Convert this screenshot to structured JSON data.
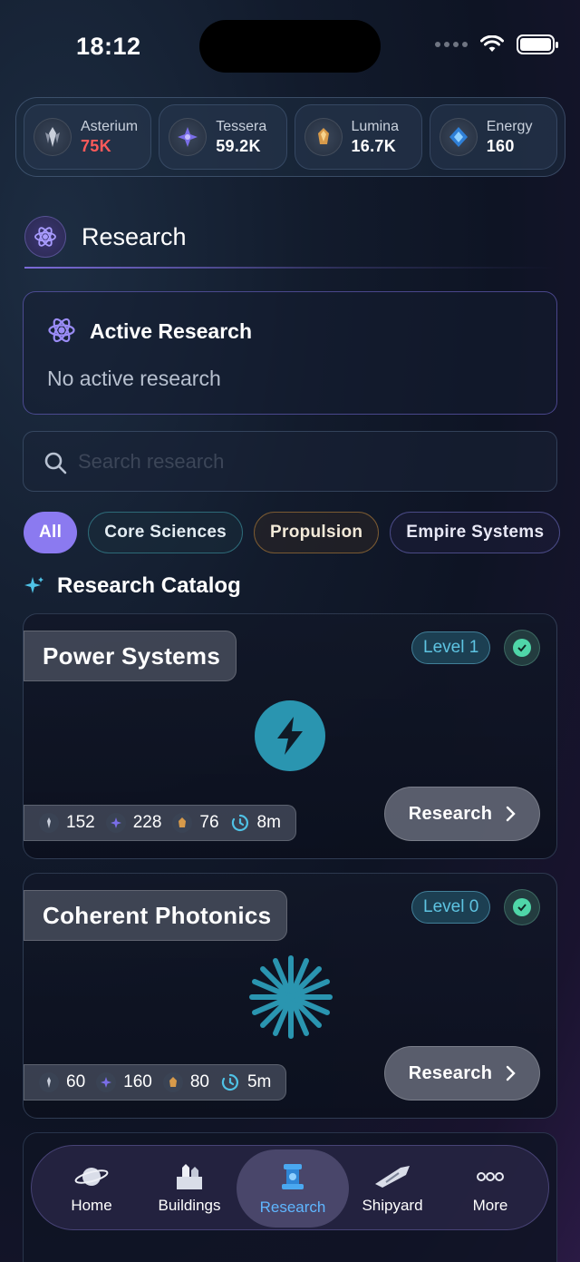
{
  "status_bar": {
    "time": "18:12"
  },
  "resources": [
    {
      "label": "Asterium",
      "value": "75K",
      "value_color": "#ff5a5a",
      "icon": "asterium-crystal-icon"
    },
    {
      "label": "Tessera",
      "value": "59.2K",
      "value_color": "#ffffff",
      "icon": "tessera-crystal-icon"
    },
    {
      "label": "Lumina",
      "value": "16.7K",
      "value_color": "#ffffff",
      "icon": "lumina-crystal-icon"
    },
    {
      "label": "Energy",
      "value": "160",
      "value_color": "#ffffff",
      "icon": "energy-crystal-icon"
    }
  ],
  "header": {
    "title": "Research",
    "icon": "atom-icon"
  },
  "active_research": {
    "title": "Active Research",
    "status": "No active research"
  },
  "search": {
    "placeholder": "Search research"
  },
  "filters": [
    "All",
    "Core Sciences",
    "Propulsion",
    "Empire Systems"
  ],
  "catalog": {
    "title": "Research Catalog",
    "icon": "sparkle-icon"
  },
  "cards": [
    {
      "title": "Power Systems",
      "level": "Level 1",
      "icon": "lightning-bolt-icon",
      "costs": {
        "asterium": "152",
        "tessera": "228",
        "lumina": "76",
        "time": "8m"
      },
      "button": "Research"
    },
    {
      "title": "Coherent Photonics",
      "level": "Level 0",
      "icon": "starburst-icon",
      "costs": {
        "asterium": "60",
        "tessera": "160",
        "lumina": "80",
        "time": "5m"
      },
      "button": "Research"
    }
  ],
  "tabbar": [
    {
      "label": "Home",
      "icon": "planet-icon"
    },
    {
      "label": "Buildings",
      "icon": "buildings-icon"
    },
    {
      "label": "Research",
      "icon": "research-lab-icon",
      "active": true
    },
    {
      "label": "Shipyard",
      "icon": "spaceship-icon"
    },
    {
      "label": "More",
      "icon": "more-dots-icon"
    }
  ],
  "colors": {
    "accent": "#8b7af0",
    "level": "#5ec4e2",
    "check": "#4fd6a8",
    "active_tab": "#5fb6ff"
  }
}
